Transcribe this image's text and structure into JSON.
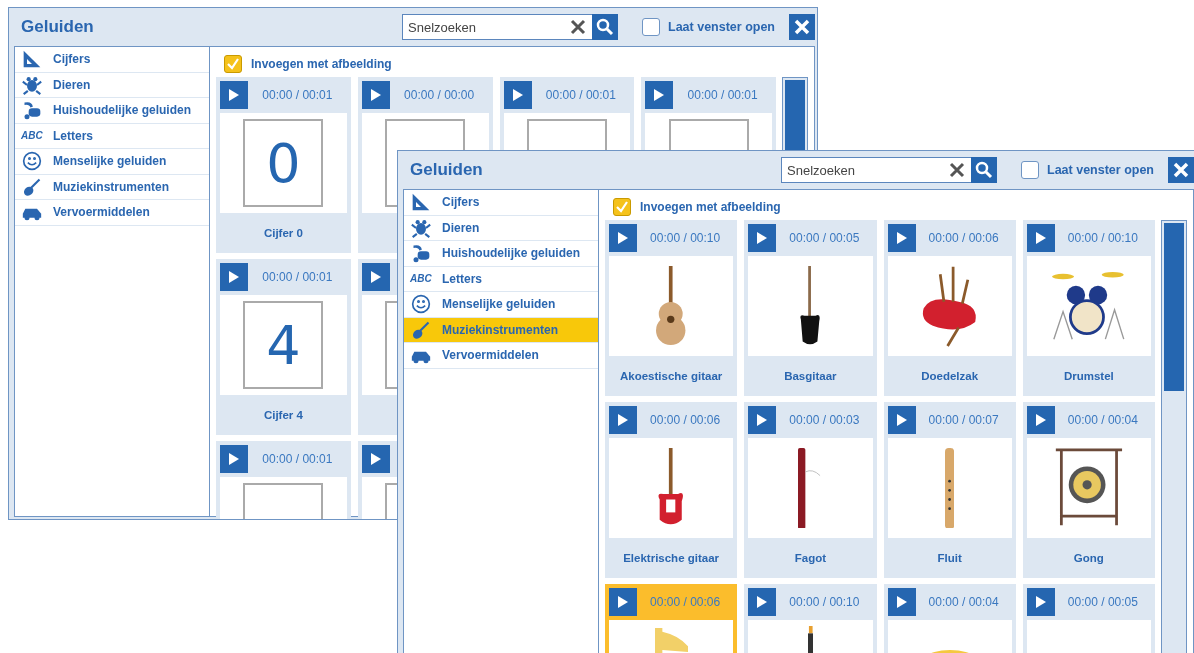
{
  "windows": [
    {
      "kind": "digits",
      "title": "Geluiden",
      "search": {
        "placeholder": "Snelzoeken"
      },
      "keep_open": {
        "label": "Laat venster open",
        "checked": false
      },
      "categories": [
        {
          "label": "Cijfers",
          "selected": false
        },
        {
          "label": "Dieren",
          "selected": false
        },
        {
          "label": "Huishoudelijke geluiden",
          "selected": false
        },
        {
          "label": "Letters",
          "selected": false,
          "icon_text": "ABC"
        },
        {
          "label": "Menselijke geluiden",
          "selected": false
        },
        {
          "label": "Muziekinstrumenten",
          "selected": false
        },
        {
          "label": "Vervoermiddelen",
          "selected": false
        }
      ],
      "insert_with_image": {
        "label": "Invoegen met afbeelding",
        "checked": true
      },
      "card_rows": [
        [
          {
            "time": "00:00 / 00:01",
            "digit": "0",
            "label": "Cijfer 0",
            "selected": false
          },
          {
            "time": "00:00 / 00:00",
            "selected": false
          },
          {
            "time": "00:00 / 00:01",
            "selected": false
          },
          {
            "time": "00:00 / 00:01",
            "selected": false
          }
        ],
        [
          {
            "time": "00:00 / 00:01",
            "digit": "4",
            "label": "Cijfer 4",
            "selected": false
          },
          {
            "selected": false
          }
        ],
        [
          {
            "time": "00:00 / 00:01",
            "selected": false
          },
          {
            "selected": false
          }
        ]
      ]
    },
    {
      "kind": "instruments",
      "title": "Geluiden",
      "search": {
        "placeholder": "Snelzoeken"
      },
      "keep_open": {
        "label": "Laat venster open",
        "checked": false
      },
      "categories": [
        {
          "label": "Cijfers",
          "selected": false
        },
        {
          "label": "Dieren",
          "selected": false
        },
        {
          "label": "Huishoudelijke geluiden",
          "selected": false
        },
        {
          "label": "Letters",
          "selected": false,
          "icon_text": "ABC"
        },
        {
          "label": "Menselijke geluiden",
          "selected": false
        },
        {
          "label": "Muziekinstrumenten",
          "selected": true
        },
        {
          "label": "Vervoermiddelen",
          "selected": false
        }
      ],
      "insert_with_image": {
        "label": "Invoegen met afbeelding",
        "checked": true
      },
      "card_rows": [
        [
          {
            "time": "00:00 / 00:10",
            "label": "Akoestische gitaar",
            "selected": false
          },
          {
            "time": "00:00 / 00:05",
            "label": "Basgitaar",
            "selected": false
          },
          {
            "time": "00:00 / 00:06",
            "label": "Doedelzak",
            "selected": false
          },
          {
            "time": "00:00 / 00:10",
            "label": "Drumstel",
            "selected": false
          }
        ],
        [
          {
            "time": "00:00 / 00:06",
            "label": "Elektrische gitaar",
            "selected": false
          },
          {
            "time": "00:00 / 00:03",
            "label": "Fagot",
            "selected": false
          },
          {
            "time": "00:00 / 00:07",
            "label": "Fluit",
            "selected": false
          },
          {
            "time": "00:00 / 00:04",
            "label": "Gong",
            "selected": false
          }
        ],
        [
          {
            "time": "00:00 / 00:06",
            "selected": true
          },
          {
            "time": "00:00 / 00:10",
            "selected": false
          },
          {
            "time": "00:00 / 00:04",
            "selected": false
          },
          {
            "time": "00:00 / 00:05",
            "selected": false
          }
        ]
      ]
    }
  ]
}
